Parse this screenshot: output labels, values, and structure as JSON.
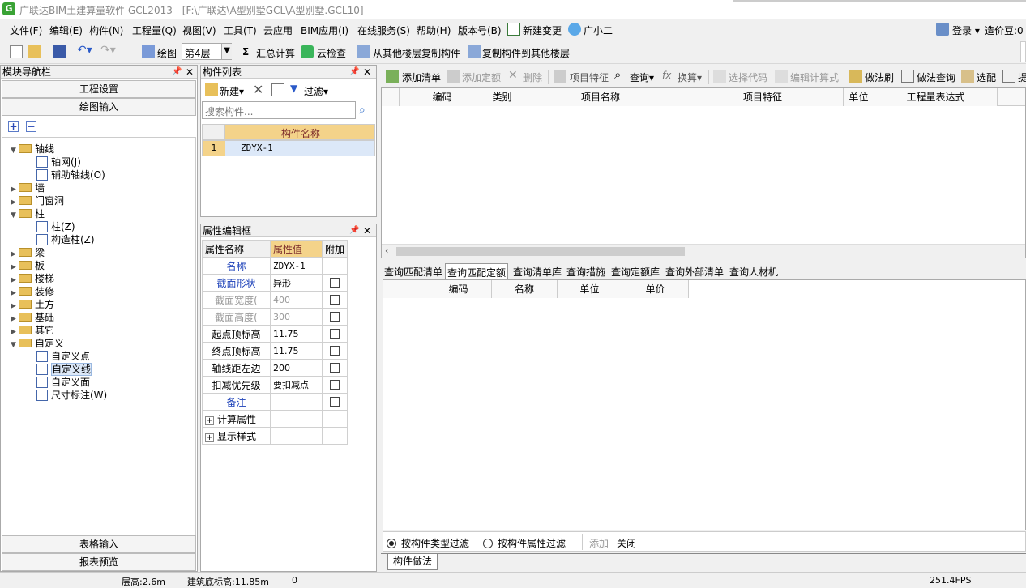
{
  "window": {
    "title": "广联达BIM土建算量软件 GCL2013 - [F:\\广联达\\A型别墅GCL\\A型别墅.GCL10]"
  },
  "menu": [
    "文件(F)",
    "编辑(E)",
    "构件(N)",
    "工程量(Q)",
    "视图(V)",
    "工具(T)",
    "云应用",
    "BIM应用(I)",
    "在线服务(S)",
    "帮助(H)",
    "版本号(B)",
    "新建变更",
    "广小二"
  ],
  "user": {
    "login": "登录",
    "coins": "造价豆:0"
  },
  "toolbar": {
    "draw": "绘图",
    "floor": "第4层",
    "sum": "汇总计算",
    "cloud_check": "云检查",
    "copy_from": "从其他楼层复制构件",
    "copy_to": "复制构件到其他楼层"
  },
  "nav": {
    "title": "模块导航栏",
    "settings": "工程设置",
    "drawing_input": "绘图输入",
    "table_input": "表格输入",
    "report_preview": "报表预览",
    "tree": [
      {
        "label": "轴线",
        "level": 0,
        "type": "folder",
        "open": true
      },
      {
        "label": "轴网(J)",
        "level": 1,
        "type": "leaf"
      },
      {
        "label": "辅助轴线(O)",
        "level": 1,
        "type": "leaf"
      },
      {
        "label": "墙",
        "level": 0,
        "type": "folder",
        "open": false
      },
      {
        "label": "门窗洞",
        "level": 0,
        "type": "folder",
        "open": false
      },
      {
        "label": "柱",
        "level": 0,
        "type": "folder",
        "open": true
      },
      {
        "label": "柱(Z)",
        "level": 1,
        "type": "leaf"
      },
      {
        "label": "构造柱(Z)",
        "level": 1,
        "type": "leaf"
      },
      {
        "label": "梁",
        "level": 0,
        "type": "folder",
        "open": false
      },
      {
        "label": "板",
        "level": 0,
        "type": "folder",
        "open": false
      },
      {
        "label": "楼梯",
        "level": 0,
        "type": "folder",
        "open": false
      },
      {
        "label": "装修",
        "level": 0,
        "type": "folder",
        "open": false
      },
      {
        "label": "土方",
        "level": 0,
        "type": "folder",
        "open": false
      },
      {
        "label": "基础",
        "level": 0,
        "type": "folder",
        "open": false
      },
      {
        "label": "其它",
        "level": 0,
        "type": "folder",
        "open": false
      },
      {
        "label": "自定义",
        "level": 0,
        "type": "folder",
        "open": true
      },
      {
        "label": "自定义点",
        "level": 1,
        "type": "leaf"
      },
      {
        "label": "自定义线",
        "level": 1,
        "type": "leaf",
        "selected": true
      },
      {
        "label": "自定义面",
        "level": 1,
        "type": "leaf"
      },
      {
        "label": "尺寸标注(W)",
        "level": 1,
        "type": "leaf"
      }
    ]
  },
  "complist": {
    "title": "构件列表",
    "new": "新建",
    "filter": "过滤",
    "search_placeholder": "搜索构件...",
    "col": "构件名称",
    "rows": [
      {
        "num": "1",
        "name": "ZDYX-1"
      }
    ]
  },
  "props": {
    "title": "属性编辑框",
    "cols": [
      "属性名称",
      "属性值",
      "附加"
    ],
    "rows": [
      {
        "name": "名称",
        "value": "ZDYX-1",
        "style": "blue",
        "chk": false
      },
      {
        "name": "截面形状",
        "value": "异形",
        "style": "blue",
        "chk": true
      },
      {
        "name": "截面宽度(",
        "value": "400",
        "style": "gray",
        "chk": true
      },
      {
        "name": "截面高度(",
        "value": "300",
        "style": "gray",
        "chk": true
      },
      {
        "name": "起点顶标高",
        "value": "11.75",
        "style": "",
        "chk": true
      },
      {
        "name": "终点顶标高",
        "value": "11.75",
        "style": "",
        "chk": true
      },
      {
        "name": "轴线距左边",
        "value": "200",
        "style": "",
        "chk": true
      },
      {
        "name": "扣减优先级",
        "value": "要扣减点",
        "style": "",
        "chk": true
      },
      {
        "name": "备注",
        "value": "",
        "style": "blue",
        "chk": true
      },
      {
        "name": "计算属性",
        "value": "",
        "style": "group",
        "chk": false
      },
      {
        "name": "显示样式",
        "value": "",
        "style": "group",
        "chk": false
      }
    ]
  },
  "rtool": [
    "添加清单",
    "添加定额",
    "删除",
    "项目特征",
    "查询",
    "换算",
    "选择代码",
    "编辑计算式",
    "做法刷",
    "做法查询",
    "选配",
    "提"
  ],
  "rtable_cols": [
    "编码",
    "类别",
    "项目名称",
    "项目特征",
    "单位",
    "工程量表达式"
  ],
  "query_tabs": [
    "查询匹配清单",
    "查询匹配定额",
    "查询清单库",
    "查询措施",
    "查询定额库",
    "查询外部清单",
    "查询人材机"
  ],
  "btable_cols": [
    "编码",
    "名称",
    "单位",
    "单价"
  ],
  "filter": {
    "by_type": "按构件类型过滤",
    "by_attr": "按构件属性过滤",
    "add": "添加",
    "close": "关闭"
  },
  "bottom_tab": "构件做法",
  "status": {
    "floor_height": "层高:2.6m",
    "base_elev": "建筑底标高:11.85m",
    "zero": "0",
    "fps": "251.4FPS"
  }
}
